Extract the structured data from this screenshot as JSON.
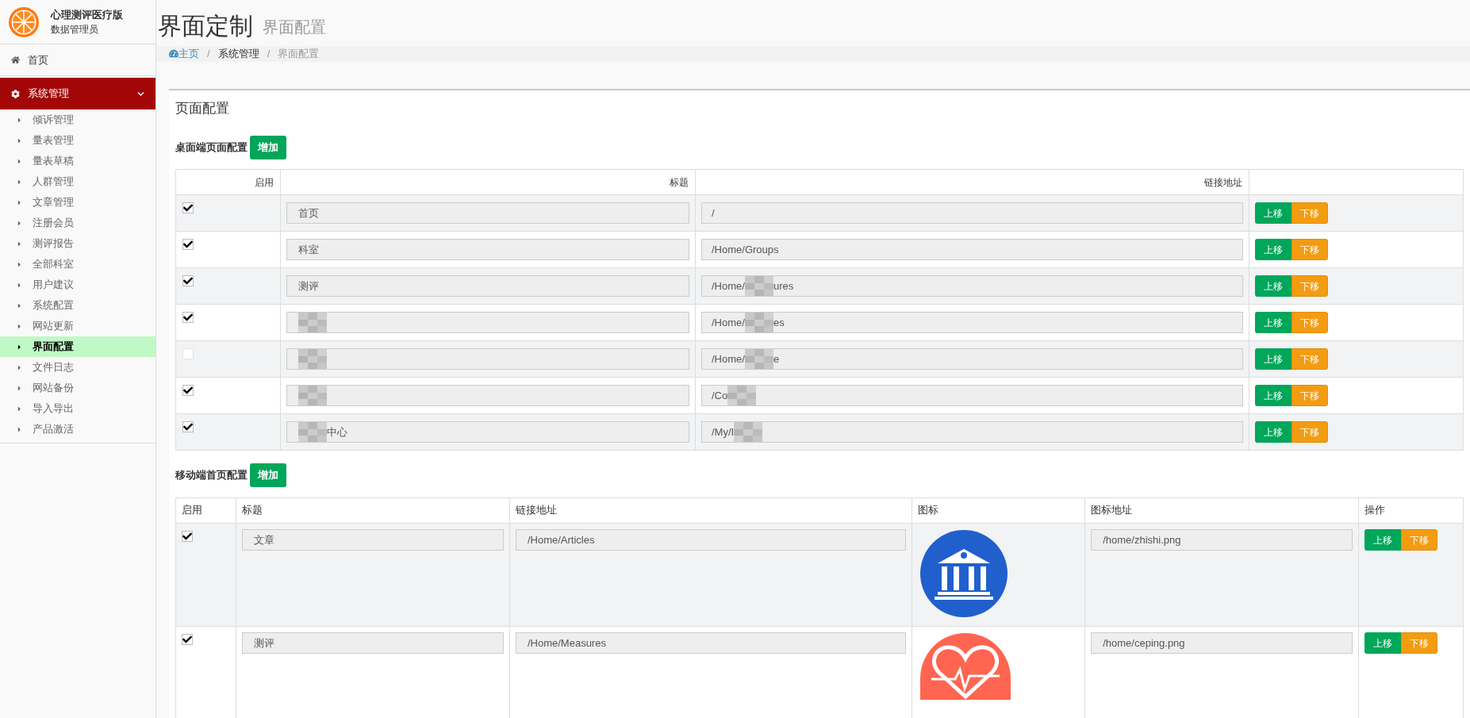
{
  "brand": {
    "title": "心理测评医疗版",
    "subtitle": "数据管理员"
  },
  "sidebar": {
    "home": {
      "label": "首页",
      "selected": false
    },
    "group": {
      "label": "系统管理",
      "expanded": true,
      "items": [
        {
          "label": "倾诉管理",
          "selected": false
        },
        {
          "label": "量表管理",
          "selected": false
        },
        {
          "label": "量表草稿",
          "selected": false
        },
        {
          "label": "人群管理",
          "selected": false
        },
        {
          "label": "文章管理",
          "selected": false
        },
        {
          "label": "注册会员",
          "selected": false
        },
        {
          "label": "测评报告",
          "selected": false
        },
        {
          "label": "全部科室",
          "selected": false
        },
        {
          "label": "用户建议",
          "selected": false
        },
        {
          "label": "系统配置",
          "selected": false
        },
        {
          "label": "网站更新",
          "selected": false
        },
        {
          "label": "界面配置",
          "selected": true
        },
        {
          "label": "文件日志",
          "selected": false
        },
        {
          "label": "网站备份",
          "selected": false
        },
        {
          "label": "导入导出",
          "selected": false
        },
        {
          "label": "产品激活",
          "selected": false
        }
      ]
    }
  },
  "page": {
    "title": "界面定制",
    "subtitle": "界面配置"
  },
  "breadcrumb": [
    {
      "label": "主页",
      "kind": "link"
    },
    {
      "separator": "/",
      "label": "系统管理",
      "kind": "text"
    },
    {
      "separator": "/",
      "label": "界面配置",
      "kind": "current"
    }
  ],
  "panel": {
    "title": "页面配置",
    "desktop": {
      "label": "桌面端页面配置",
      "add_button": "增加",
      "columns": [
        "启用",
        "标题",
        "链接地址"
      ],
      "rows": [
        {
          "checked": true,
          "title": {
            "before": "首页"
          },
          "link": {
            "before": "/"
          },
          "up": "上移",
          "down": "下移"
        },
        {
          "checked": true,
          "title": {
            "before": "科室"
          },
          "link": {
            "before": "/Home/Groups"
          },
          "up": "上移",
          "down": "下移"
        },
        {
          "checked": true,
          "title": {
            "before": "测评"
          },
          "link": {
            "before": "/Home/",
            "redacted": true,
            "after": "ures"
          },
          "up": "上移",
          "down": "下移"
        },
        {
          "checked": true,
          "title": {
            "redacted": true
          },
          "link": {
            "before": "/Home/",
            "redacted": true,
            "after": "es"
          },
          "up": "上移",
          "down": "下移"
        },
        {
          "checked": false,
          "title": {
            "redacted": true
          },
          "link": {
            "before": "/Home/",
            "redacted": true,
            "after": "e"
          },
          "up": "上移",
          "down": "下移"
        },
        {
          "checked": true,
          "title": {
            "redacted": true
          },
          "link": {
            "before": "/Co",
            "redacted": true
          },
          "up": "上移",
          "down": "下移"
        },
        {
          "checked": true,
          "title": {
            "redacted": true,
            "after": "中心"
          },
          "link": {
            "before": "/My/I",
            "redacted": true
          },
          "up": "上移",
          "down": "下移"
        }
      ]
    },
    "mobile": {
      "label": "移动端首页配置",
      "add_button": "增加",
      "columns": [
        "启用",
        "标题",
        "链接地址",
        "图标",
        "图标地址",
        "操作"
      ],
      "rows": [
        {
          "checked": true,
          "title": "文章",
          "link": "/Home/Articles",
          "kind": "bank",
          "icon_path": "/home/zhishi.png",
          "up": "上移",
          "down": "下移"
        },
        {
          "checked": true,
          "title": "测评",
          "link": "/Home/Measures",
          "kind": "heart",
          "icon_path": "/home/ceping.png",
          "up": "上移",
          "down": "下移"
        }
      ]
    }
  }
}
